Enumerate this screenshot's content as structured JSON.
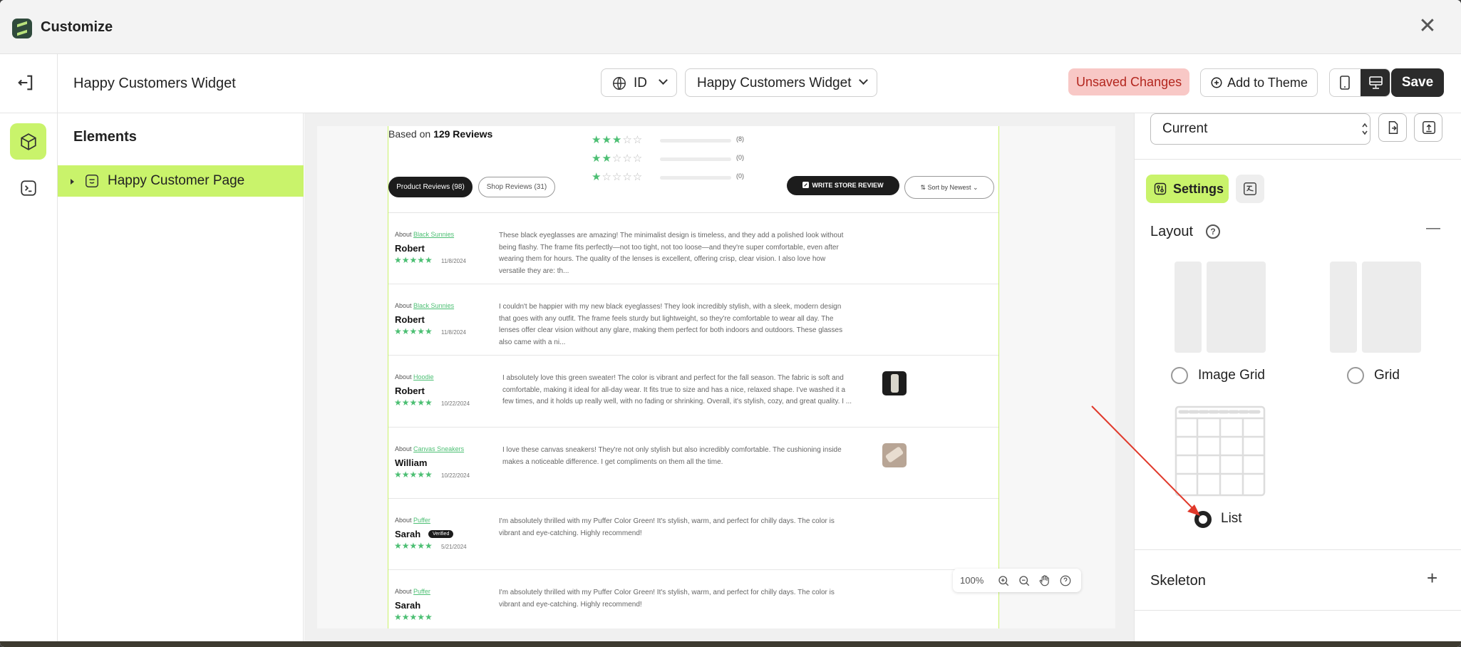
{
  "window": {
    "title": "Customize",
    "close_glyph": "✕"
  },
  "toolbar": {
    "page_name": "Happy Customers Widget",
    "language": "ID",
    "widget_select": "Happy Customers Widget",
    "unsaved": "Unsaved Changes",
    "add_to_theme": "Add to Theme",
    "save": "Save"
  },
  "elements_panel": {
    "title": "Elements",
    "tree": [
      {
        "label": "Happy Customer Page"
      }
    ]
  },
  "preview": {
    "based_on_prefix": "Based on",
    "based_on_count": "129 Reviews",
    "distribution": [
      {
        "stars": 3,
        "count": "(8)"
      },
      {
        "stars": 2,
        "count": "(0)"
      },
      {
        "stars": 1,
        "count": "(0)"
      }
    ],
    "tabs": [
      "Product Reviews (98)",
      "Shop Reviews (31)"
    ],
    "write_button": "WRITE STORE REVIEW",
    "sort": "Sort by Newest",
    "reviews": [
      {
        "about": "About",
        "product": "Black Sunnies",
        "name": "Robert",
        "badge": "",
        "date": "11/8/2024",
        "text": "These black eyeglasses are amazing! The minimalist design is timeless, and they add a polished look without being flashy. The frame fits perfectly—not too tight, not too loose—and they're super comfortable, even after wearing them for hours. The quality of the lenses is excellent, offering crisp, clear vision. I also love how versatile they are: th...",
        "thumb": ""
      },
      {
        "about": "About",
        "product": "Black Sunnies",
        "name": "Robert",
        "badge": "",
        "date": "11/8/2024",
        "text": "I couldn't be happier with my new black eyeglasses! They look incredibly stylish, with a sleek, modern design that goes with any outfit. The frame feels sturdy but lightweight, so they're comfortable to wear all day. The lenses offer clear vision without any glare, making them perfect for both indoors and outdoors. These glasses also came with a ni...",
        "thumb": ""
      },
      {
        "about": "About",
        "product": "Hoodie",
        "name": "Robert",
        "badge": "",
        "date": "10/22/2024",
        "text": "I absolutely love this green sweater! The color is vibrant and perfect for the fall season. The fabric is soft and comfortable, making it ideal for all-day wear. It fits true to size and has a nice, relaxed shape. I've washed it a few times, and it holds up really well, with no fading or shrinking. Overall, it's stylish, cozy, and great quality. I ...",
        "thumb": "photo"
      },
      {
        "about": "About",
        "product": "Canvas Sneakers",
        "name": "William",
        "badge": "",
        "date": "10/22/2024",
        "text": "I love these canvas sneakers! They're not only stylish but also incredibly comfortable. The cushioning inside makes a noticeable difference. I get compliments on them all the time.",
        "thumb": "photo"
      },
      {
        "about": "About",
        "product": "Puffer",
        "name": "Sarah",
        "badge": "Verified",
        "date": "5/21/2024",
        "text": "I'm absolutely thrilled with my Puffer Color Green! It's stylish, warm, and perfect for chilly days. The color is vibrant and eye-catching. Highly recommend!",
        "thumb": ""
      },
      {
        "about": "About",
        "product": "Puffer",
        "name": "Sarah",
        "badge": "",
        "date": "",
        "text": "I'm absolutely thrilled with my Puffer Color Green! It's stylish, warm, and perfect for chilly days. The color is vibrant and eye-catching. Highly recommend!",
        "thumb": ""
      }
    ],
    "zoom": "100%"
  },
  "settings_panel": {
    "version_select": "Current",
    "tab_settings": "Settings",
    "layout_title": "Layout",
    "help_glyph": "?",
    "layout_options": [
      {
        "label": "Image Grid",
        "selected": false
      },
      {
        "label": "Grid",
        "selected": false
      },
      {
        "label": "List",
        "selected": true
      }
    ],
    "skeleton_title": "Skeleton",
    "collapse_glyph": "—",
    "expand_glyph": "+"
  },
  "colors": {
    "accent": "#c9f36b",
    "star": "#4cbf73",
    "dark": "#2b2b2b",
    "unsaved_bg": "#f8c8c6",
    "unsaved_fg": "#b3261e",
    "annotation_arrow": "#e0392b"
  },
  "icons": [
    "app-logo-icon",
    "close-icon",
    "exit-icon",
    "globe-icon",
    "chevron-down-icon",
    "plus-circle-icon",
    "mobile-icon",
    "desktop-icon",
    "cube-icon",
    "terminal-icon",
    "caret-right-icon",
    "page-icon",
    "star-icon",
    "zoom-in-icon",
    "zoom-out-icon",
    "hand-icon",
    "help-icon",
    "updown-icon",
    "import-icon",
    "export-icon",
    "settings-icon",
    "translate-icon",
    "minus-icon",
    "plus-icon"
  ]
}
